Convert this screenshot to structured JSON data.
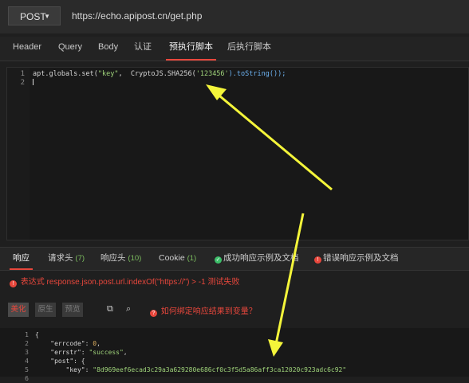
{
  "request": {
    "method": "POST",
    "url": "https://echo.apipost.cn/get.php"
  },
  "request_tabs": [
    {
      "label": "Header"
    },
    {
      "label": "Query"
    },
    {
      "label": "Body"
    },
    {
      "label": "认证"
    },
    {
      "label": "预执行脚本",
      "active": true
    },
    {
      "label": "后执行脚本"
    }
  ],
  "editor": {
    "line_numbers": [
      "1",
      "2"
    ],
    "code_prefix": "apt.globals.set(",
    "code_key": "\"key\"",
    "code_mid": ",  CryptoJS.SHA256(",
    "code_arg": "'123456'",
    "code_suffix": ").toString());"
  },
  "response_tabs": [
    {
      "label": "响应",
      "active": true
    },
    {
      "label": "请求头",
      "count": "(7)"
    },
    {
      "label": "响应头",
      "count": "(10)"
    },
    {
      "label": "Cookie",
      "count": "(1)"
    },
    {
      "label": "成功响应示例及文档",
      "status": "success"
    },
    {
      "label": "错误响应示例及文档",
      "status": "error"
    }
  ],
  "error_message": "表达式 response.json.post.url.indexOf(\"https://\") > -1 测试失败",
  "view_modes": [
    "美化",
    "原生",
    "预览"
  ],
  "binding_hint": "如何绑定响应结果到变量？",
  "response_body": {
    "line_numbers": [
      "1",
      "2",
      "3",
      "4",
      "5",
      "6"
    ],
    "open_brace": "{",
    "errcode_key": "\"errcode\"",
    "errcode_value": "0",
    "errstr_key": "\"errstr\"",
    "errstr_value": "\"success\"",
    "post_key": "\"post\"",
    "key_key": "\"key\"",
    "key_value": "\"8d969eef6ecad3c29a3a629280e686cf0c3f5d5a86aff3ca12020c923adc6c92\""
  },
  "colors": {
    "accent": "#e8473c",
    "arrow": "#f4f53a",
    "success": "#3dbf6a",
    "string": "#9fd37a"
  }
}
